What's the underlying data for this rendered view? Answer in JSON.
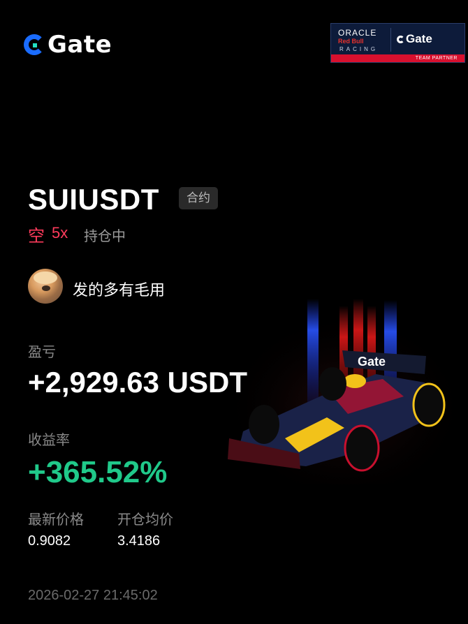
{
  "brand": {
    "name": "Gate"
  },
  "partner": {
    "line1": "ORACLE",
    "line2": "Red Bull",
    "line3": "RACING",
    "brand": "Gate",
    "tag": "TEAM PARTNER",
    "colors": {
      "navy": "#0d1b3a",
      "red": "#d8102e"
    }
  },
  "position": {
    "symbol": "SUIUSDT",
    "type_tag": "合约",
    "side": "空",
    "leverage": "5x",
    "status": "持仓中"
  },
  "user": {
    "name": "发的多有毛用"
  },
  "pnl": {
    "label": "盈亏",
    "value": "+2,929.63 USDT"
  },
  "roi": {
    "label": "收益率",
    "value": "+365.52%"
  },
  "prices": {
    "latest_label": "最新价格",
    "latest_value": "0.9082",
    "open_label": "开仓均价",
    "open_value": "3.4186"
  },
  "timestamp": "2026-02-27 21:45:02",
  "car_livery_text": "Gate",
  "colors": {
    "short": "#ff3b5c",
    "profit": "#20c98a",
    "accent": "#1a6cff"
  }
}
